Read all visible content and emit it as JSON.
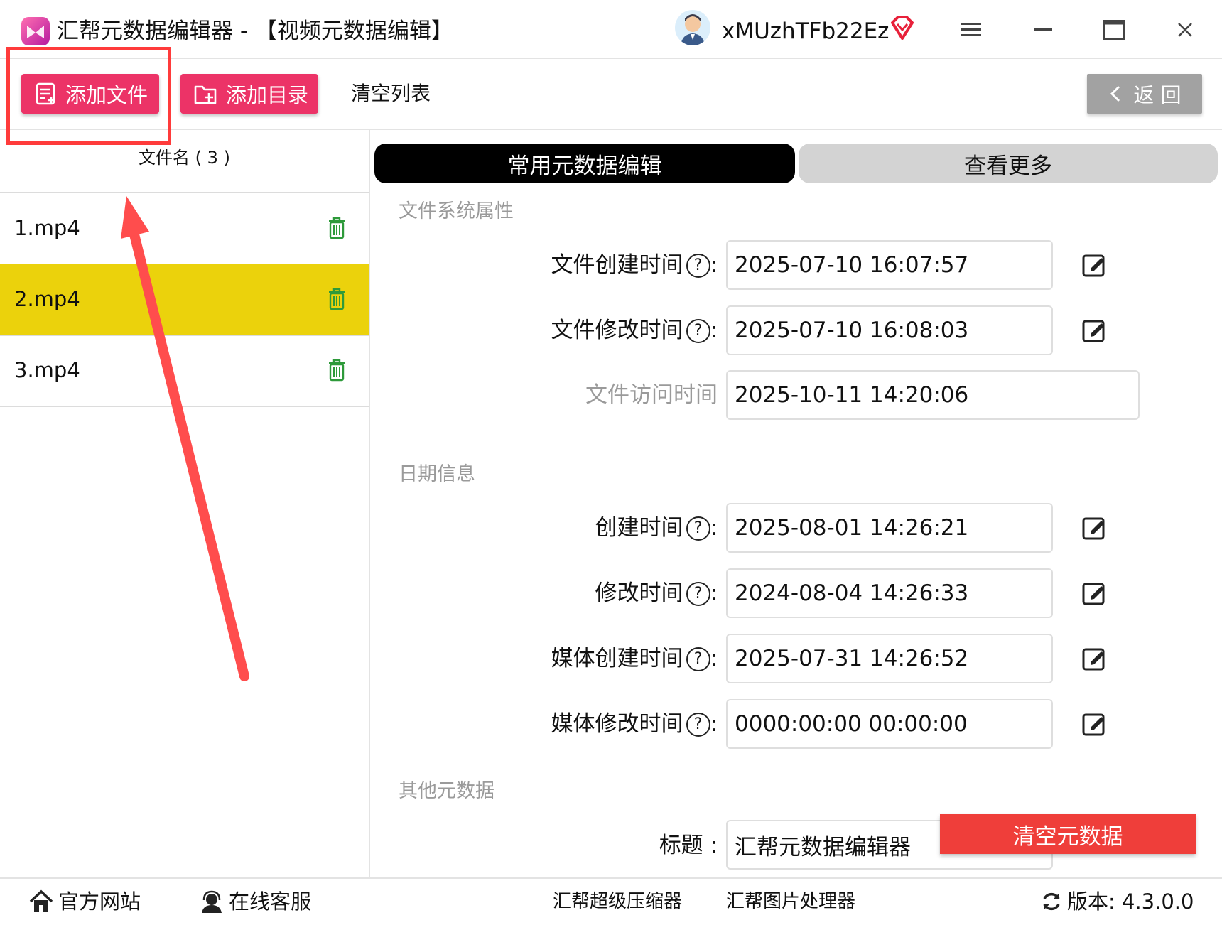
{
  "titlebar": {
    "app_title": "汇帮元数据编辑器 - 【视频元数据编辑】",
    "username": "xMUzhTFb22Ez",
    "menu_icon": "hamburger-icon",
    "minimize_icon": "minimize-icon",
    "maximize_icon": "maximize-icon",
    "close_icon": "close-icon"
  },
  "toolbar": {
    "add_file_label": "添加文件",
    "add_folder_label": "添加目录",
    "clear_list_label": "清空列表",
    "back_label": "返 回"
  },
  "file_list": {
    "header": "文件名 ( 3 )",
    "files": [
      {
        "name": "1.mp4",
        "selected": false
      },
      {
        "name": "2.mp4",
        "selected": true
      },
      {
        "name": "3.mp4",
        "selected": false
      }
    ]
  },
  "tabs": {
    "common": "常用元数据编辑",
    "more": "查看更多"
  },
  "sections": {
    "filesystem": {
      "title": "文件系统属性",
      "fields": [
        {
          "label": "文件创建时间",
          "value": "2025-07-10 16:07:57"
        },
        {
          "label": "文件修改时间",
          "value": "2025-07-10 16:08:03"
        },
        {
          "label": "文件访问时间",
          "value": "2025-10-11 14:20:06"
        }
      ]
    },
    "date": {
      "title": "日期信息",
      "fields": [
        {
          "label": "创建时间",
          "value": "2025-08-01 14:26:21"
        },
        {
          "label": "修改时间",
          "value": "2024-08-04 14:26:33"
        },
        {
          "label": "媒体创建时间",
          "value": "2025-07-31 14:26:52"
        },
        {
          "label": "媒体修改时间",
          "value": "0000:00:00 00:00:00"
        }
      ]
    },
    "other": {
      "title": "其他元数据",
      "fields": [
        {
          "label": "标题 :",
          "value": "汇帮元数据编辑器"
        }
      ]
    }
  },
  "colon": ":",
  "qmark": "?",
  "clear_metadata_label": "清空元数据",
  "footer": {
    "website": "官方网站",
    "support": "在线客服",
    "compressor": "汇帮超级压缩器",
    "image_tool": "汇帮图片处理器",
    "version": "版本:  4.3.0.0"
  },
  "colors": {
    "primary_button": "#ec3367",
    "selected_row": "#ebd20c",
    "danger_button": "#ef3e3a",
    "annotation": "#ff3b3b",
    "trash_icon": "#2e9a3a"
  }
}
